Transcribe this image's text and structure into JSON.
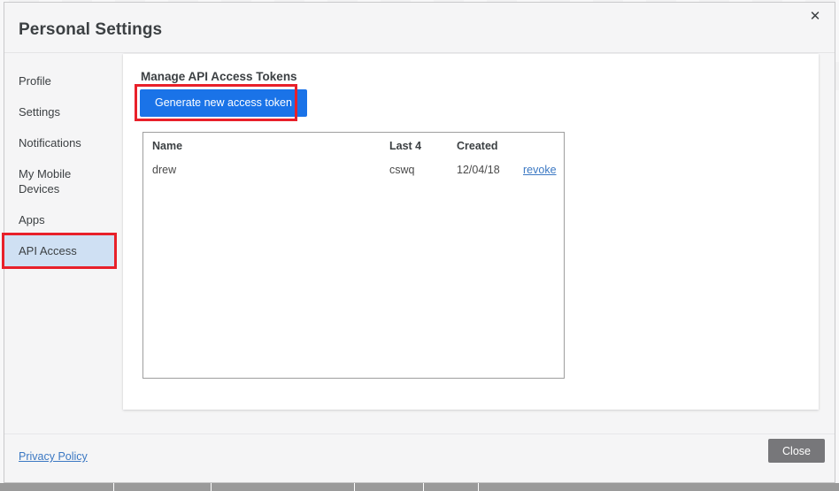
{
  "dialog": {
    "title": "Personal Settings",
    "close_icon": "close-x-icon",
    "close_icon_glyph": "✕"
  },
  "sidebar": {
    "items": [
      {
        "label": "Profile",
        "active": false
      },
      {
        "label": "Settings",
        "active": false
      },
      {
        "label": "Notifications",
        "active": false
      },
      {
        "label": "My Mobile Devices",
        "active": false
      },
      {
        "label": "Apps",
        "active": false
      },
      {
        "label": "API Access",
        "active": true
      }
    ]
  },
  "main": {
    "card_title": "Manage API Access Tokens",
    "generate_button": "Generate new access token",
    "table": {
      "columns": [
        "Name",
        "Last 4",
        "Created",
        ""
      ],
      "rows": [
        {
          "name": "drew",
          "last4": "cswq",
          "created": "12/04/18",
          "action": "revoke"
        }
      ]
    }
  },
  "footer": {
    "privacy_link": "Privacy Policy",
    "close_button": "Close"
  },
  "colors": {
    "accent_blue": "#1a73e8",
    "link_blue": "#3b78c3",
    "highlight_red": "#e8202a",
    "nav_active_bg": "#cfe0f3",
    "close_button_gray": "#77777a",
    "dialog_bg": "#f5f5f6",
    "card_bg": "#ffffff"
  }
}
